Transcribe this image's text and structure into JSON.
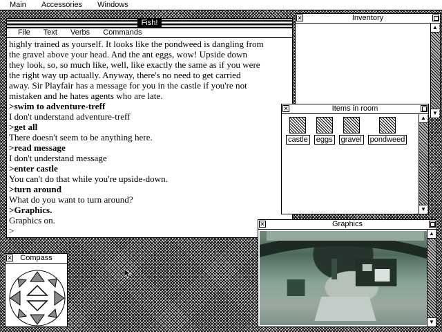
{
  "menubar": {
    "items": [
      "Main",
      "Accessories",
      "Windows"
    ]
  },
  "fish_window": {
    "title": "Fish!",
    "menu": [
      "File",
      "Text",
      "Verbs",
      "Commands"
    ],
    "lines": [
      {
        "text": "highly trained as yourself. It looks like the pondweed is dangling from",
        "bold": false
      },
      {
        "text": "the gravel above your head. And the ant eggs, wow! Upside down",
        "bold": false
      },
      {
        "text": "they look, so, so much like, well, like exactly the same as if you were",
        "bold": false
      },
      {
        "text": "the right way up actually. Anyway, there's no need to get carried",
        "bold": false
      },
      {
        "text": "away. Sir Playfair has a message for you in the castle if you're not",
        "bold": false
      },
      {
        "text": "mistaken and he hates agents who are late.",
        "bold": false
      },
      {
        "text": ">swim to adventure-treff",
        "bold": true
      },
      {
        "text": "I don't understand adventure-treff",
        "bold": false
      },
      {
        "text": ">get all",
        "bold": true
      },
      {
        "text": "There doesn't seem to be anything here.",
        "bold": false
      },
      {
        "text": ">read message",
        "bold": true
      },
      {
        "text": "I don't understand message",
        "bold": false
      },
      {
        "text": ">enter castle",
        "bold": true
      },
      {
        "text": "You can't do that while you're upside-down.",
        "bold": false
      },
      {
        "text": ">turn around",
        "bold": true
      },
      {
        "text": "What do you want to turn around?",
        "bold": false
      },
      {
        "text": ">Graphics.",
        "bold": true
      },
      {
        "text": "Graphics on.",
        "bold": false
      },
      {
        "text": ">",
        "bold": false
      }
    ]
  },
  "inventory_window": {
    "title": "Inventory"
  },
  "items_window": {
    "title": "Items in room",
    "items": [
      "castle",
      "eggs",
      "gravel",
      "pondweed"
    ]
  },
  "graphics_window": {
    "title": "Graphics"
  },
  "compass_window": {
    "title": "Compass"
  }
}
